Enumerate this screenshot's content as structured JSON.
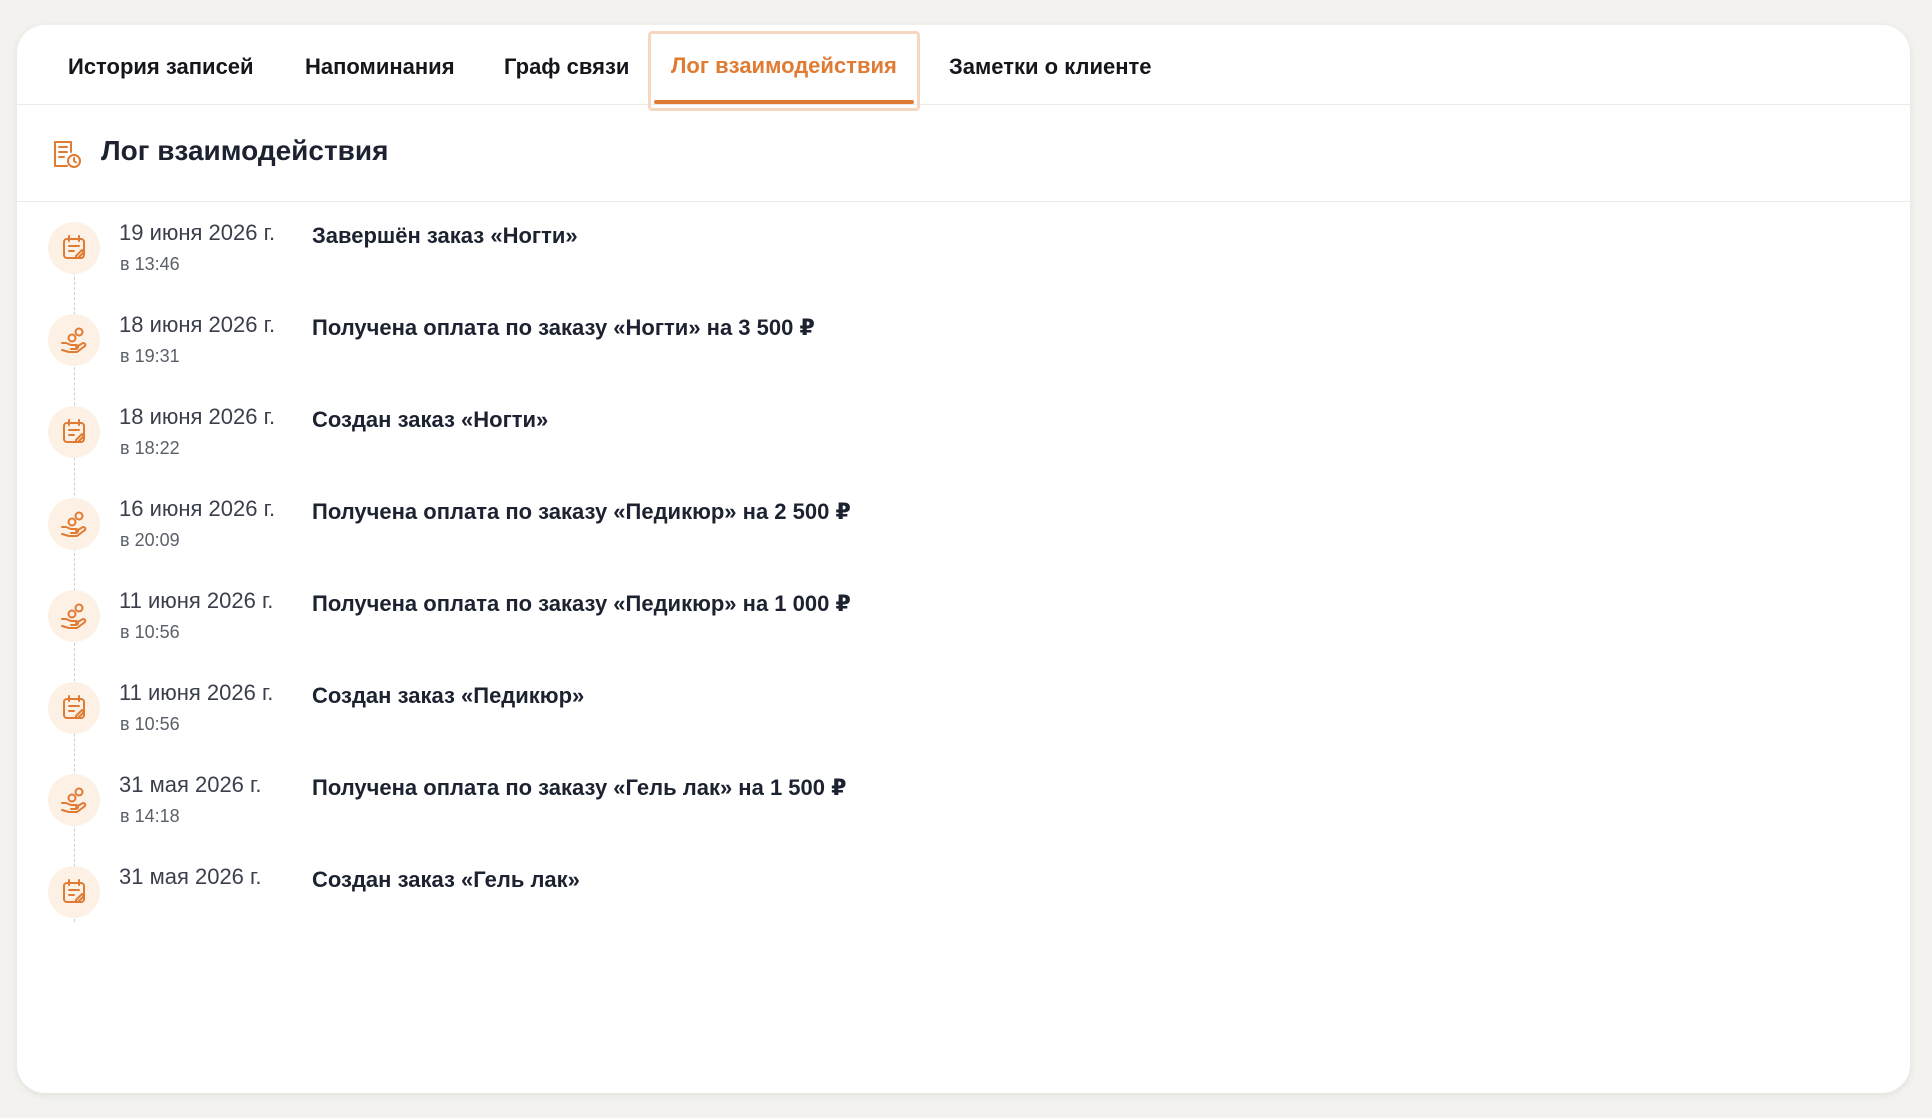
{
  "tabs": [
    {
      "label": "История записей",
      "active": false
    },
    {
      "label": "Напоминания",
      "active": false
    },
    {
      "label": "Граф связи",
      "active": false
    },
    {
      "label": "Лог взаимодействия",
      "active": true
    },
    {
      "label": "Заметки о клиенте",
      "active": false
    }
  ],
  "section": {
    "title": "Лог взаимодействия",
    "icon": "log-document-clock-icon"
  },
  "accent_color": "#e07b34",
  "entries": [
    {
      "date": "19 июня 2026 г.",
      "time": "в 13:46",
      "text": "Завершён заказ «Ногти»",
      "icon": "order-icon"
    },
    {
      "date": "18 июня 2026 г.",
      "time": "в 19:31",
      "text": "Получена оплата по заказу «Ногти» на 3 500 ₽",
      "icon": "payment-icon"
    },
    {
      "date": "18 июня 2026 г.",
      "time": "в 18:22",
      "text": "Создан заказ «Ногти»",
      "icon": "order-icon"
    },
    {
      "date": "16 июня 2026 г.",
      "time": "в 20:09",
      "text": "Получена оплата по заказу «Педикюр» на 2 500 ₽",
      "icon": "payment-icon"
    },
    {
      "date": "11 июня 2026 г.",
      "time": "в 10:56",
      "text": "Получена оплата по заказу «Педикюр» на 1 000 ₽",
      "icon": "payment-icon"
    },
    {
      "date": "11 июня 2026 г.",
      "time": "в 10:56",
      "text": "Создан заказ «Педикюр»",
      "icon": "order-icon"
    },
    {
      "date": "31 мая 2026 г.",
      "time": "в 14:18",
      "text": "Получена оплата по заказу «Гель лак» на 1 500 ₽",
      "icon": "payment-icon"
    },
    {
      "date": "31 мая 2026 г.",
      "time": "",
      "text": "Создан заказ «Гель лак»",
      "icon": "order-icon"
    }
  ]
}
